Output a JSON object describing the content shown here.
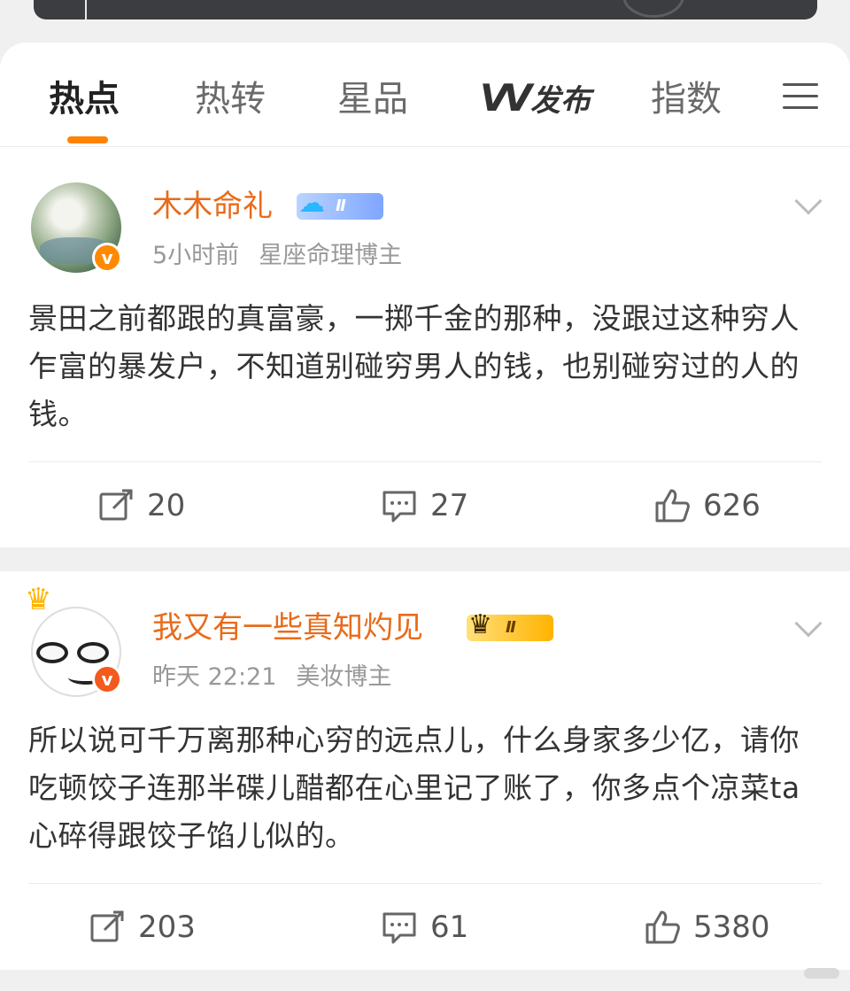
{
  "tabs": [
    "热点",
    "热转",
    "星品",
    "发布",
    "指数"
  ],
  "posts": [
    {
      "username": "木木命礼",
      "level_label": "Ⅱ",
      "time": "5小时前",
      "category": "星座命理博主",
      "text": "景田之前都跟的真富豪，一掷千金的那种，没跟过这种穷人乍富的暴发户，不知道别碰穷男人的钱，也别碰穷过的人的钱。",
      "reposts": "20",
      "comments": "27",
      "likes": "626"
    },
    {
      "username": "我又有一些真知灼见",
      "level_label": "Ⅱ",
      "time": "昨天 22:21",
      "category": "美妆博主",
      "text": "所以说可千万离那种心穷的远点儿，什么身家多少亿，请你吃顿饺子连那半碟儿醋都在心里记了账了，你多点个凉菜ta心碎得跟饺子馅儿似的。",
      "reposts": "203",
      "comments": "61",
      "likes": "5380"
    }
  ],
  "colors": {
    "accent": "#ff8200",
    "username": "#e86b1a"
  },
  "icons": [
    "repost-icon",
    "comment-icon",
    "like-icon",
    "menu-icon",
    "chevron-down-icon",
    "verified-badge-icon",
    "crown-icon"
  ]
}
